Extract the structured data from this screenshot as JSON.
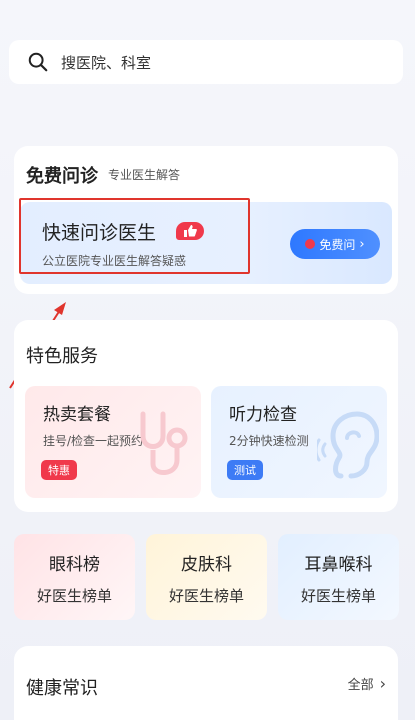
{
  "search": {
    "placeholder": "搜医院、科室",
    "icon": "search-icon"
  },
  "free_consult": {
    "title": "免费问诊",
    "subtitle": "专业医生解答",
    "quick": {
      "title": "快速问诊医生",
      "subtitle": "公立医院专业医生解答疑惑",
      "button_label": "免费问"
    }
  },
  "special": {
    "title": "特色服务",
    "tiles": [
      {
        "title": "热卖套餐",
        "subtitle": "挂号/检查一起预约",
        "tag": "特惠"
      },
      {
        "title": "听力检查",
        "subtitle": "2分钟快速检测",
        "tag": "测试"
      }
    ]
  },
  "rankings": [
    {
      "title": "眼科榜",
      "subtitle": "好医生榜单"
    },
    {
      "title": "皮肤科",
      "subtitle": "好医生榜单"
    },
    {
      "title": "耳鼻喉科",
      "subtitle": "好医生榜单"
    }
  ],
  "health": {
    "title": "健康常识",
    "more_label": "全部"
  },
  "colors": {
    "accent_blue": "#3d7bf5",
    "accent_red": "#f0394b",
    "highlight_red": "#e0352d"
  }
}
